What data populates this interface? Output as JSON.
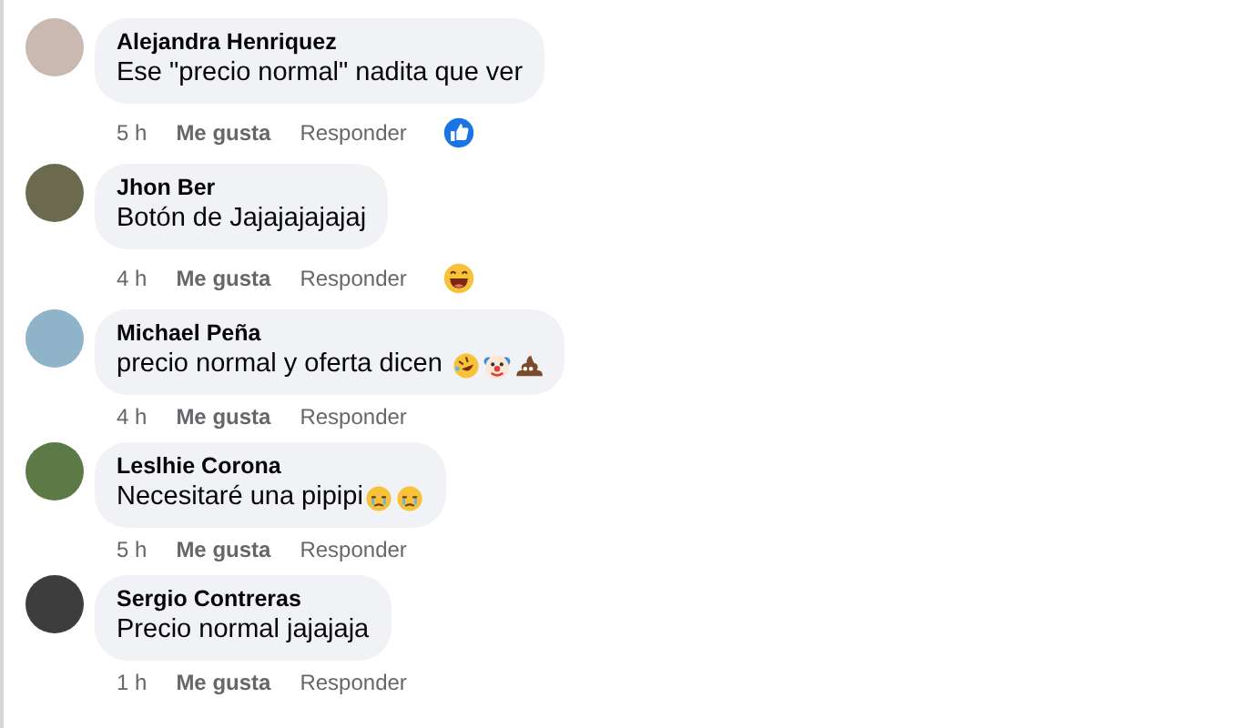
{
  "comments": [
    {
      "name": "Alejandra Henriquez",
      "text": "Ese \"precio normal\" nadita que ver",
      "time": "5 h",
      "like_label": "Me gusta",
      "reply_label": "Responder",
      "reaction": {
        "kind": "like"
      }
    },
    {
      "name": "Jhon Ber",
      "text": "Botón de Jajajajajajaj",
      "time": "4 h",
      "like_label": "Me gusta",
      "reply_label": "Responder",
      "reaction": {
        "kind": "grin"
      }
    },
    {
      "name": "Michael Peña",
      "text": "precio normal y oferta dicen ",
      "inline_emojis": [
        {
          "kind": "rofl"
        },
        {
          "kind": "clown"
        },
        {
          "kind": "poop"
        }
      ],
      "time": "4 h",
      "like_label": "Me gusta",
      "reply_label": "Responder"
    },
    {
      "name": "Leslhie Corona",
      "text": "Necesitaré una pipipi",
      "inline_emojis": [
        {
          "kind": "sad"
        },
        {
          "kind": "sad"
        }
      ],
      "time": "5 h",
      "like_label": "Me gusta",
      "reply_label": "Responder"
    },
    {
      "name": "Sergio Contreras",
      "text": "Precio normal jajajaja",
      "time": "1 h",
      "like_label": "Me gusta",
      "reply_label": "Responder"
    }
  ]
}
